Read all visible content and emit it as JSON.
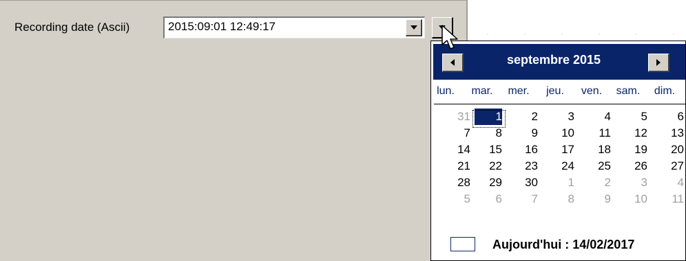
{
  "field": {
    "label": "Recording date (Ascii)",
    "value": "2015:09:01 12:49:17"
  },
  "calendar": {
    "month_title": "septembre 2015",
    "weekdays": [
      "lun.",
      "mar.",
      "mer.",
      "jeu.",
      "ven.",
      "sam.",
      "dim."
    ],
    "weeks": [
      [
        "31",
        "1",
        "2",
        "3",
        "4",
        "5",
        "6"
      ],
      [
        "7",
        "8",
        "9",
        "10",
        "11",
        "12",
        "13"
      ],
      [
        "14",
        "15",
        "16",
        "17",
        "18",
        "19",
        "20"
      ],
      [
        "21",
        "22",
        "23",
        "24",
        "25",
        "26",
        "27"
      ],
      [
        "28",
        "29",
        "30",
        "1",
        "2",
        "3",
        "4"
      ],
      [
        "5",
        "6",
        "7",
        "8",
        "9",
        "10",
        "11"
      ]
    ],
    "selected_day": "1",
    "today_label": "Aujourd'hui : 14/02/2017",
    "colors": {
      "header": "#0a246a",
      "other_month": "#a0a0a0"
    }
  },
  "icons": {
    "dropdown": "chevron-down-icon",
    "prev": "triangle-left-icon",
    "next": "triangle-right-icon",
    "cursor": "mouse-pointer-icon"
  }
}
